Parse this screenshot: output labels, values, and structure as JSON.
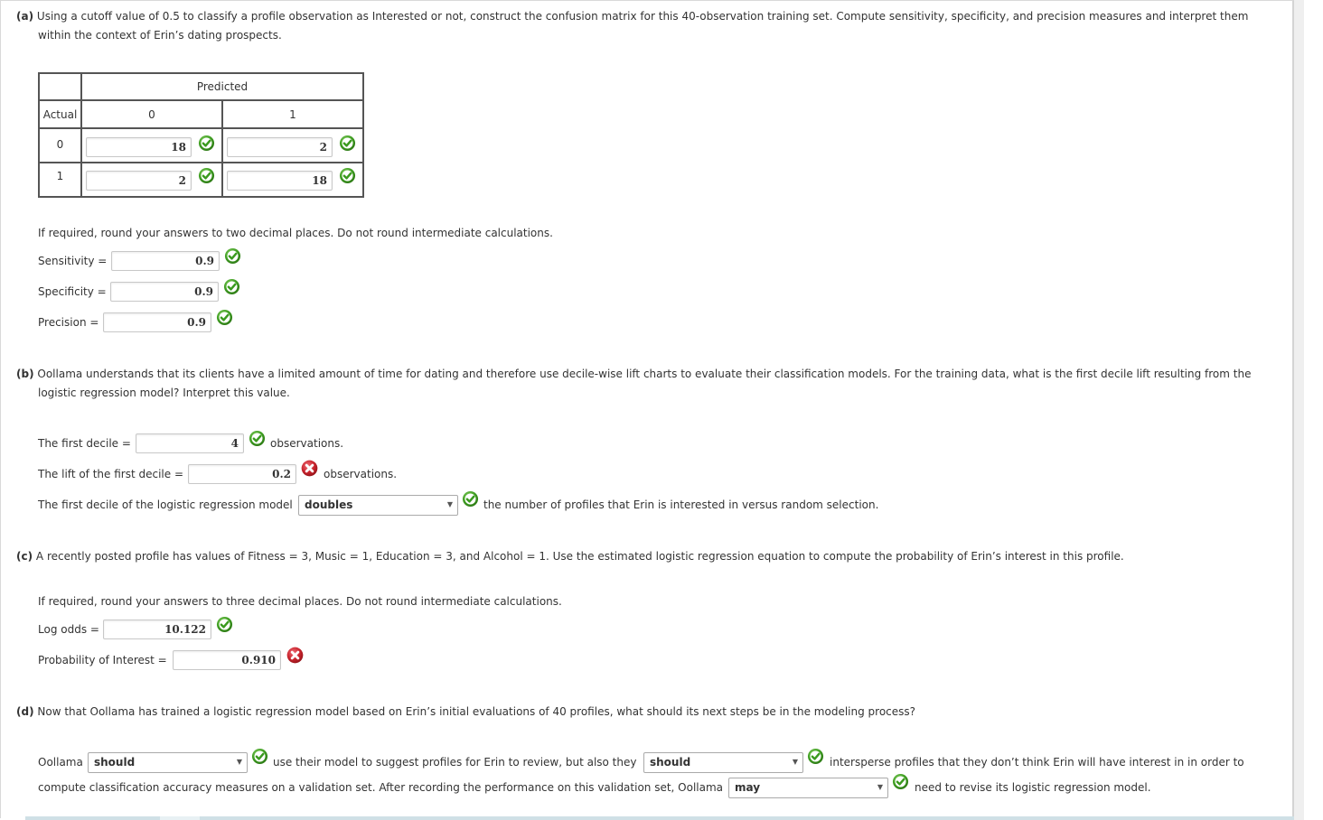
{
  "part_a": {
    "label": "(a)",
    "text_line1": "Using a cutoff value of 0.5 to classify a profile observation as Interested or not, construct the confusion matrix for this 40-observation training set. Compute sensitivity, specificity, and precision measures and interpret them",
    "text_line2": "within the context of Erin’s dating prospects.",
    "matrix": {
      "header_predicted": "Predicted",
      "header_actual": "Actual",
      "col_labels": [
        "0",
        "1"
      ],
      "rows": [
        {
          "label": "0",
          "cells": [
            {
              "value": "18",
              "status": "correct"
            },
            {
              "value": "2",
              "status": "correct"
            }
          ]
        },
        {
          "label": "1",
          "cells": [
            {
              "value": "2",
              "status": "correct"
            },
            {
              "value": "18",
              "status": "correct"
            }
          ]
        }
      ]
    },
    "instruction": "If required, round your answers to two decimal places. Do not round intermediate calculations.",
    "sensitivity": {
      "label": "Sensitivity =",
      "value": "0.9",
      "status": "correct"
    },
    "specificity": {
      "label": "Specificity =",
      "value": "0.9",
      "status": "correct"
    },
    "precision": {
      "label": "Precision =",
      "value": "0.9",
      "status": "correct"
    }
  },
  "part_b": {
    "label": "(b)",
    "text_line1": "Oollama understands that its clients have a limited amount of time for dating and therefore use decile-wise lift charts to evaluate their classification models. For the training data, what is the first decile lift resulting from the",
    "text_line2": "logistic regression model? Interpret this value.",
    "first_decile": {
      "label": "The first decile =",
      "value": "4",
      "status": "correct",
      "suffix": "observations."
    },
    "lift": {
      "label": "The lift of the first decile =",
      "value": "0.2",
      "status": "incorrect",
      "suffix": "observations."
    },
    "interpretation": {
      "prefix": "The first decile of the logistic regression model",
      "selected": "doubles",
      "status": "correct",
      "suffix": "the number of profiles that Erin is interested in versus random selection."
    }
  },
  "part_c": {
    "label": "(c)",
    "text": "A recently posted profile has values of Fitness = 3, Music = 1, Education = 3, and Alcohol = 1. Use the estimated logistic regression equation to compute the probability of Erin’s interest in this profile.",
    "instruction": "If required, round your answers to three decimal places. Do not round intermediate calculations.",
    "log_odds": {
      "label": "Log odds =",
      "value": "10.122",
      "status": "correct"
    },
    "probability": {
      "label": "Probability of Interest =",
      "value": "0.910",
      "status": "incorrect"
    }
  },
  "part_d": {
    "label": "(d)",
    "text": "Now that Oollama has trained a logistic regression model based on Erin’s initial evaluations of 40 profiles, what should its next steps be in the modeling process?",
    "line1_prefix": "Oollama",
    "select1": {
      "selected": "should",
      "status": "correct"
    },
    "line1_mid": "use their model to suggest profiles for Erin to review, but also they",
    "select2": {
      "selected": "should",
      "status": "correct"
    },
    "line1_suffix": "intersperse profiles that they don’t think Erin will have interest in in order to",
    "line2_prefix": "compute classification accuracy measures on a validation set. After recording the performance on this validation set, Oollama",
    "select3": {
      "selected": "may",
      "status": "correct"
    },
    "line2_suffix": "need to revise its logistic regression model."
  },
  "colors": {
    "correct": "#3a9a1e",
    "incorrect": "#c0262c"
  }
}
